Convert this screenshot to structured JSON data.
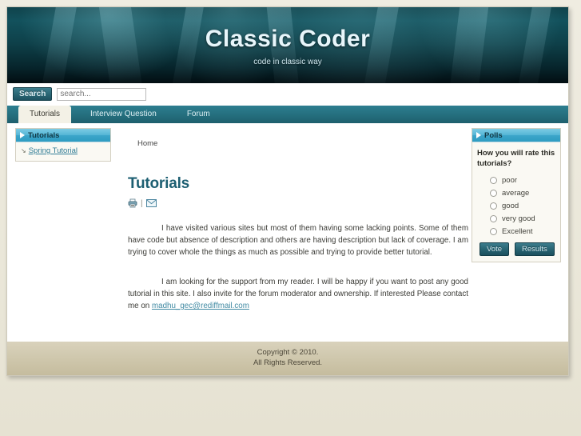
{
  "banner": {
    "title": "Classic Coder",
    "tagline": "code in classic way"
  },
  "search": {
    "button_label": "Search",
    "placeholder": "search...",
    "value": ""
  },
  "nav": {
    "tabs": [
      {
        "label": "Tutorials",
        "active": true
      },
      {
        "label": "Interview Question",
        "active": false
      },
      {
        "label": "Forum",
        "active": false
      }
    ]
  },
  "sidebar": {
    "box": {
      "title": "Tutorials",
      "icon": "play-triangle-icon",
      "links": [
        {
          "label": "Spring Tutorial",
          "bullet": "arrow-bullet-icon"
        }
      ]
    }
  },
  "content": {
    "breadcrumb": "Home",
    "heading": "Tutorials",
    "tools": [
      {
        "icon": "printer-icon",
        "title": "Print"
      },
      {
        "separator": "|"
      },
      {
        "icon": "email-icon",
        "title": "Email"
      }
    ],
    "paragraph_1": "I have visited various sites but most of them having some lacking points. Some of them have code but absence of description and others are having description but lack of coverage. I am trying to cover whole the things as much as possible and trying to provide better tutorial.",
    "paragraph_2_before": "I am looking for the support from my reader. I will be happy if you want to post any good tutorial in this site. I also invite for the forum moderator and ownership. If interested Please contact me on ",
    "paragraph_2_link": "madhu_gec@rediffmail.com"
  },
  "polls": {
    "box_title": "Polls",
    "icon": "play-triangle-icon",
    "question": "How you will rate this tutorials?",
    "options": [
      {
        "label": "poor",
        "selected": false
      },
      {
        "label": "average",
        "selected": false
      },
      {
        "label": "good",
        "selected": false
      },
      {
        "label": "very good",
        "selected": false
      },
      {
        "label": "Excellent",
        "selected": false
      }
    ],
    "vote_label": "Vote",
    "results_label": "Results"
  },
  "footer": {
    "line_1": "Copyright © 2010.",
    "line_2": "All Rights Reserved."
  },
  "colors": {
    "banner_dark": "#07262d",
    "nav_teal": "#25707f",
    "accent_blue": "#3ca5c9",
    "heading_teal": "#1d5f72",
    "link_teal": "#2f7c95",
    "footer_tan": "#cec6ab",
    "page_bg": "#eae7d9"
  }
}
